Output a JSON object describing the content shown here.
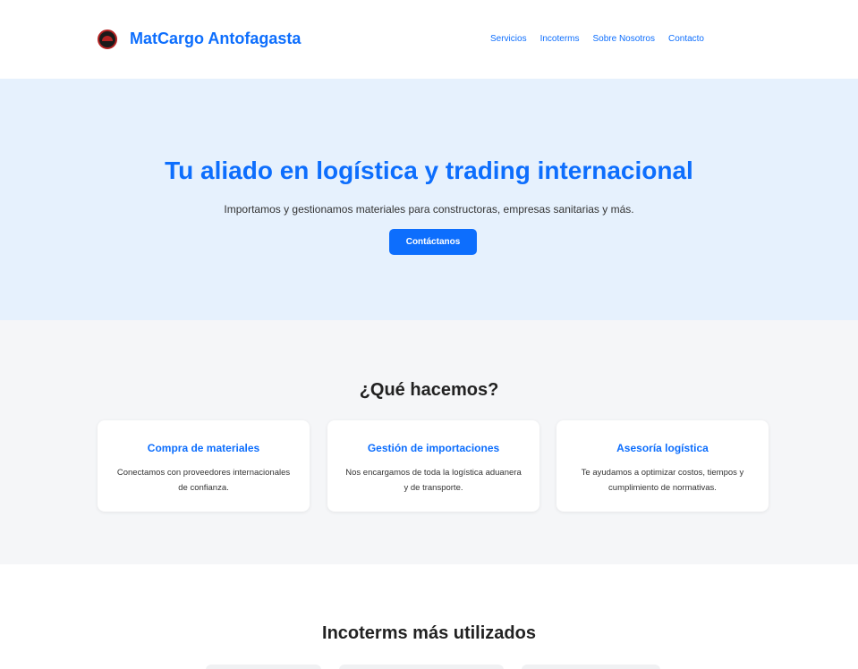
{
  "header": {
    "logo_icon": "matcargo-logo-icon",
    "brand": "MatCargo Antofagasta",
    "nav": [
      {
        "label": "Servicios"
      },
      {
        "label": "Incoterms"
      },
      {
        "label": "Sobre Nosotros"
      },
      {
        "label": "Contacto"
      }
    ]
  },
  "hero": {
    "title": "Tu aliado en logística y trading internacional",
    "subtitle": "Importamos y gestionamos materiales para constructoras, empresas sanitarias y más.",
    "cta_label": "Contáctanos"
  },
  "services": {
    "title": "¿Qué hacemos?",
    "cards": [
      {
        "title": "Compra de materiales",
        "text": "Conectamos con proveedores internacionales de confianza."
      },
      {
        "title": "Gestión de importaciones",
        "text": "Nos encargamos de toda la logística aduanera y de transporte."
      },
      {
        "title": "Asesoría logística",
        "text": "Te ayudamos a optimizar costos, tiempos y cumplimiento de normativas."
      }
    ]
  },
  "incoterms": {
    "title": "Incoterms más utilizados"
  },
  "colors": {
    "accent": "#0d6efd",
    "hero_bg": "#e6f1fd",
    "section_bg": "#f5f6f8"
  }
}
